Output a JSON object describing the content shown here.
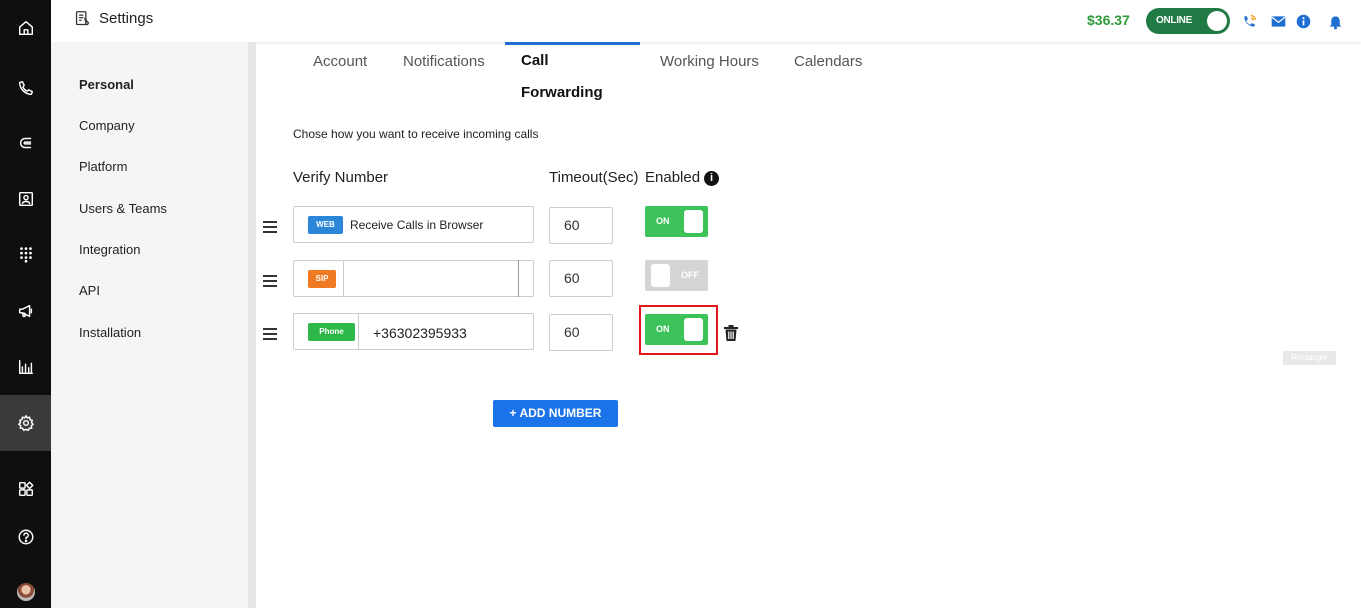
{
  "app": {
    "title": "Settings"
  },
  "header": {
    "balance": "$36.37",
    "status": "ONLINE"
  },
  "rail": {
    "items": [
      "home",
      "calls",
      "contacts-flow",
      "contacts",
      "dialpad",
      "campaigns",
      "analytics",
      "settings",
      "integrations",
      "help"
    ],
    "active": "settings"
  },
  "sidebar": {
    "items": [
      {
        "label": "Personal",
        "active": true
      },
      {
        "label": "Company"
      },
      {
        "label": "Platform"
      },
      {
        "label": "Users & Teams"
      },
      {
        "label": "Integration"
      },
      {
        "label": "API"
      },
      {
        "label": "Installation"
      }
    ]
  },
  "tabs": [
    {
      "label": "Account"
    },
    {
      "label": "Notifications"
    },
    {
      "label": "Call Forwarding",
      "active": true
    },
    {
      "label": "Working Hours"
    },
    {
      "label": "Calendars"
    }
  ],
  "main": {
    "description": "Chose how you want to receive incoming calls",
    "col_number": "Verify Number",
    "col_timeout": "Timeout(Sec)",
    "col_enabled": "Enabled",
    "rows": [
      {
        "badge": "WEB",
        "badge_color": "#2b86d9",
        "value": "Receive Calls in Browser",
        "timeout": "60",
        "toggle": "ON",
        "enabled": true
      },
      {
        "badge": "SIP",
        "badge_color": "#f07a22",
        "value": "",
        "timeout": "60",
        "toggle": "OFF",
        "enabled": false
      },
      {
        "badge": "Phone",
        "badge_color": "#2fb84a",
        "value": "+36302395933",
        "timeout": "60",
        "toggle": "ON",
        "enabled": true
      }
    ],
    "add_button": "+ ADD NUMBER",
    "annotation_tag": "Rectangle"
  }
}
